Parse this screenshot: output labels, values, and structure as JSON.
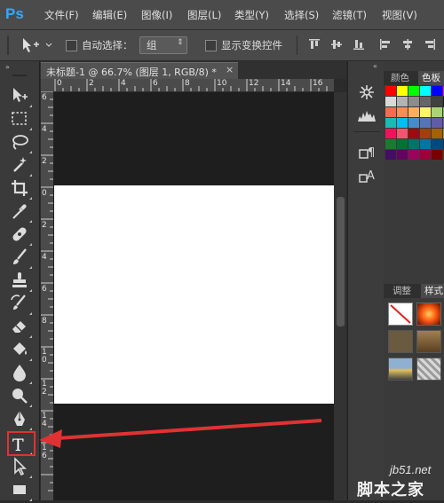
{
  "app": {
    "logo": "Ps"
  },
  "menu": [
    "文件(F)",
    "编辑(E)",
    "图像(I)",
    "图层(L)",
    "类型(Y)",
    "选择(S)",
    "滤镜(T)",
    "视图(V)"
  ],
  "options_bar": {
    "auto_select_label": "自动选择：",
    "auto_select_value": "组",
    "show_transform_label": "显示变换控件"
  },
  "document": {
    "tab_title": "未标题-1 @ 66.7% (图层 1, RGB/8) *",
    "close_glyph": "×",
    "ruler_h_ticks": [
      "0",
      "2",
      "4",
      "6",
      "8",
      "10",
      "12",
      "14",
      "16"
    ],
    "ruler_v_ticks": [
      "6",
      "4",
      "2",
      "0",
      "2",
      "4",
      "6",
      "8",
      "1 0",
      "1 2",
      "1 4",
      "1 6"
    ]
  },
  "panels": {
    "color_tab": "颜色",
    "swatches_tab": "色板",
    "adjustments_tab": "调整",
    "styles_tab": "样式"
  },
  "swatch_colors": [
    "#ff0000",
    "#ffff00",
    "#00ff00",
    "#00ffff",
    "#0000ff",
    "#ff00ff",
    "#ffffff",
    "#d9d9d9",
    "#b3b3b3",
    "#8c8c8c",
    "#666666",
    "#404040",
    "#1a1a1a",
    "#000000",
    "#f26c4f",
    "#f68e56",
    "#fbaf5d",
    "#fff568",
    "#acd373",
    "#7cc576",
    "#3cb878",
    "#1abbb4",
    "#00bff3",
    "#448ccb",
    "#5574b9",
    "#605ca8",
    "#855fa8",
    "#a763a8",
    "#ed145b",
    "#f0566e",
    "#9e0b0f",
    "#a0410d",
    "#a36209",
    "#aba000",
    "#598527",
    "#1a7b30",
    "#007236",
    "#00746b",
    "#0076a3",
    "#004a80",
    "#003471",
    "#1b1464",
    "#440e62",
    "#630460",
    "#9e005d",
    "#9e0039",
    "#790000",
    "#7b2e00",
    "#7d4900"
  ],
  "style_swatch_colors": [
    "#a07a48",
    "#8c6a3c",
    "#5a7aa0",
    "#cfcfcf"
  ],
  "watermark": {
    "site": "jb51.net",
    "name": "脚本之家"
  },
  "accent": {
    "ps_blue": "#31a8ff",
    "highlight_red": "#e03232"
  }
}
